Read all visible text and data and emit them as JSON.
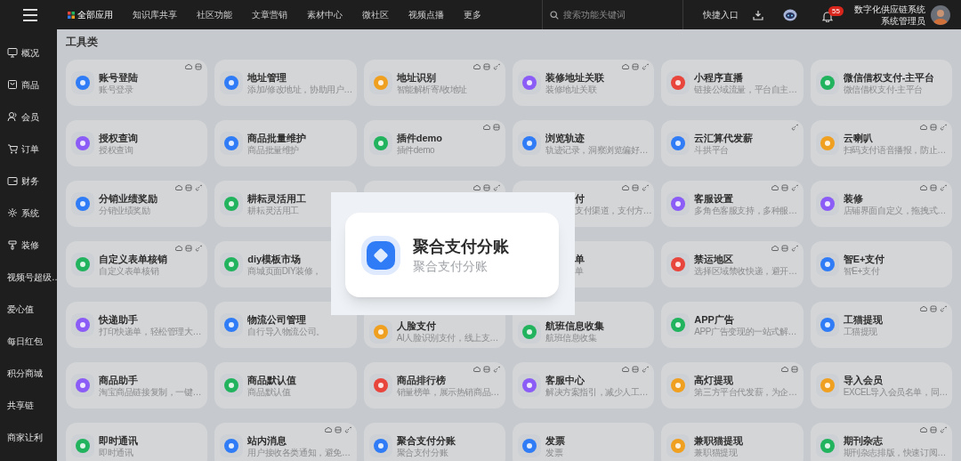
{
  "top_bar": {
    "nav": [
      {
        "label": "全部应用",
        "selected": true
      },
      {
        "label": "知识库共享",
        "selected": false
      },
      {
        "label": "社区功能",
        "selected": false
      },
      {
        "label": "文章营销",
        "selected": false
      },
      {
        "label": "素材中心",
        "selected": false
      },
      {
        "label": "微社区",
        "selected": false
      },
      {
        "label": "视频点播",
        "selected": false
      },
      {
        "label": "更多",
        "selected": false
      }
    ],
    "search": {
      "placeholder": "搜索功能关键词"
    },
    "quick_entry": "快捷入口",
    "notifications": "55",
    "user": {
      "org": "数字化供应链系统",
      "role": "系统管理员"
    }
  },
  "sidebar": {
    "items": [
      {
        "label": "概况"
      },
      {
        "label": "商品"
      },
      {
        "label": "会员"
      },
      {
        "label": "订单"
      },
      {
        "label": "财务"
      },
      {
        "label": "系统"
      },
      {
        "label": "装修"
      },
      {
        "label": "视频号超级…"
      },
      {
        "label": "爱心值"
      },
      {
        "label": "每日红包"
      },
      {
        "label": "积分商城"
      },
      {
        "label": "共享链"
      },
      {
        "label": "商家让利"
      }
    ]
  },
  "section_title": "工具类",
  "cards": [
    {
      "kind": "full",
      "title": "账号登陆",
      "subtitle": "账号登录",
      "color": "#2f7cf6",
      "cloud": true,
      "storage": true,
      "link": false
    },
    {
      "kind": "full",
      "title": "地址管理",
      "subtitle": "添加/修改地址，协助用户…",
      "color": "#2f7cf6",
      "cloud": false,
      "storage": false,
      "link": false
    },
    {
      "kind": "full",
      "title": "地址识别",
      "subtitle": "智能解析寄/收地址",
      "color": "#f0a020",
      "cloud": true,
      "storage": true,
      "link": true
    },
    {
      "kind": "full",
      "title": "装修地址关联",
      "subtitle": "装修地址关联",
      "color": "#8b5cf6",
      "cloud": true,
      "storage": true,
      "link": true
    },
    {
      "kind": "full",
      "title": "小程序直播",
      "subtitle": "链接公域流量，平台自主…",
      "color": "#e8453c",
      "cloud": false,
      "storage": false,
      "link": false
    },
    {
      "kind": "full",
      "title": "微信借权支付-主平台",
      "subtitle": "微信借权支付-主平台",
      "color": "#22b35e",
      "cloud": false,
      "storage": false,
      "link": false
    },
    {
      "kind": "full",
      "title": "授权查询",
      "subtitle": "授权查询",
      "color": "#8b5cf6",
      "cloud": false,
      "storage": false,
      "link": false
    },
    {
      "kind": "full",
      "title": "商品批量维护",
      "subtitle": "商品批量维护",
      "color": "#2f7cf6",
      "cloud": false,
      "storage": false,
      "link": false
    },
    {
      "kind": "full",
      "title": "插件demo",
      "subtitle": "插件demo",
      "color": "#22b35e",
      "cloud": true,
      "storage": true,
      "link": false
    },
    {
      "kind": "full",
      "title": "浏览轨迹",
      "subtitle": "轨迹记录，洞察浏览偏好…",
      "color": "#2f7cf6",
      "cloud": false,
      "storage": false,
      "link": false
    },
    {
      "kind": "full",
      "title": "云汇算代发薪",
      "subtitle": "斗拱平台",
      "color": "#2f7cf6",
      "cloud": false,
      "storage": false,
      "link": true
    },
    {
      "kind": "full",
      "title": "云喇叭",
      "subtitle": "扫码支付语音播报，防止…",
      "color": "#f0a020",
      "cloud": true,
      "storage": true,
      "link": true
    },
    {
      "kind": "full",
      "title": "分销业绩奖励",
      "subtitle": "分销业绩奖励",
      "color": "#2f7cf6",
      "cloud": true,
      "storage": true,
      "link": true
    },
    {
      "kind": "full",
      "title": "耕耘灵活用工",
      "subtitle": "耕耘灵活用工",
      "color": "#22b35e",
      "cloud": false,
      "storage": false,
      "link": false
    },
    {
      "kind": "top",
      "cloud": true,
      "storage": true,
      "link": true
    },
    {
      "kind": "partial",
      "title": "付",
      "subtitle": "支付渠道，支付方…",
      "cloud": true,
      "storage": true,
      "link": true
    },
    {
      "kind": "full",
      "title": "客服设置",
      "subtitle": "多角色客服支持，多种服…",
      "color": "#8b5cf6",
      "cloud": true,
      "storage": true,
      "link": true
    },
    {
      "kind": "full",
      "title": "装修",
      "subtitle": "店铺界面自定义，拖拽式…",
      "color": "#8b5cf6",
      "cloud": true,
      "storage": true,
      "link": true
    },
    {
      "kind": "full",
      "title": "自定义表单核销",
      "subtitle": "自定义表单核销",
      "color": "#22b35e",
      "cloud": true,
      "storage": true,
      "link": true
    },
    {
      "kind": "left",
      "title": "diy模板市场",
      "subtitle": "商城页面DIY装修，",
      "color": "#22b35e",
      "cloud": false,
      "storage": false,
      "link": false
    },
    {
      "kind": "hidden"
    },
    {
      "kind": "partial",
      "title": "单",
      "subtitle": "单",
      "cloud": false,
      "storage": false,
      "link": false
    },
    {
      "kind": "full",
      "title": "禁运地区",
      "subtitle": "选择区域禁收快递，避开…",
      "color": "#e8453c",
      "cloud": true,
      "storage": true,
      "link": true
    },
    {
      "kind": "full",
      "title": "智E+支付",
      "subtitle": "智E+支付",
      "color": "#2f7cf6",
      "cloud": false,
      "storage": false,
      "link": false
    },
    {
      "kind": "full",
      "title": "快递助手",
      "subtitle": "打印快递单，轻松管理大…",
      "color": "#8b5cf6",
      "cloud": false,
      "storage": false,
      "link": false
    },
    {
      "kind": "full",
      "title": "物流公司管理",
      "subtitle": "自行导入物流公司。",
      "color": "#2f7cf6",
      "cloud": false,
      "storage": false,
      "link": false
    },
    {
      "kind": "under",
      "title": "人脸支付",
      "subtitle": "AI人脸识别支付，线上支…",
      "color": "#f0a020",
      "cloud": false,
      "storage": false,
      "link": false
    },
    {
      "kind": "under",
      "title": "航班信息收集",
      "subtitle": "航班信息收集",
      "color": "#22b35e",
      "cloud": false,
      "storage": false,
      "link": false
    },
    {
      "kind": "full",
      "title": "APP广告",
      "subtitle": "APP广告变现的一站式解…",
      "color": "#22b35e",
      "cloud": false,
      "storage": false,
      "link": false
    },
    {
      "kind": "full",
      "title": "工猫提现",
      "subtitle": "工猫提现",
      "color": "#2f7cf6",
      "cloud": true,
      "storage": true,
      "link": true
    },
    {
      "kind": "full",
      "title": "商品助手",
      "subtitle": "淘宝商品链接复制，一键…",
      "color": "#8b5cf6",
      "cloud": false,
      "storage": false,
      "link": false
    },
    {
      "kind": "full",
      "title": "商品默认值",
      "subtitle": "商品默认值",
      "color": "#22b35e",
      "cloud": false,
      "storage": false,
      "link": false
    },
    {
      "kind": "full",
      "title": "商品排行榜",
      "subtitle": "销量榜单，展示热销商品…",
      "color": "#e8453c",
      "cloud": true,
      "storage": true,
      "link": true
    },
    {
      "kind": "full",
      "title": "客服中心",
      "subtitle": "解决方案指引，减少人工…",
      "color": "#8b5cf6",
      "cloud": true,
      "storage": true,
      "link": true
    },
    {
      "kind": "full",
      "title": "高灯提现",
      "subtitle": "第三方平台代发薪，为企…",
      "color": "#f0a020",
      "cloud": true,
      "storage": true,
      "link": false
    },
    {
      "kind": "full",
      "title": "导入会员",
      "subtitle": "EXCEL导入会员名单，同…",
      "color": "#f0a020",
      "cloud": false,
      "storage": false,
      "link": false
    },
    {
      "kind": "full",
      "title": "即时通讯",
      "subtitle": "即时通讯",
      "color": "#22b35e",
      "cloud": false,
      "storage": false,
      "link": false
    },
    {
      "kind": "full",
      "title": "站内消息",
      "subtitle": "用户接收各类通知，避免…",
      "color": "#2f7cf6",
      "cloud": true,
      "storage": true,
      "link": true
    },
    {
      "kind": "full",
      "title": "聚合支付分账",
      "subtitle": "聚合支付分账",
      "color": "#2f7cf6",
      "cloud": false,
      "storage": false,
      "link": false
    },
    {
      "kind": "full",
      "title": "发票",
      "subtitle": "发票",
      "color": "#2f7cf6",
      "cloud": false,
      "storage": false,
      "link": false
    },
    {
      "kind": "full",
      "title": "兼职猫提现",
      "subtitle": "兼职猫提现",
      "color": "#f0a020",
      "cloud": false,
      "storage": false,
      "link": false
    },
    {
      "kind": "full",
      "title": "期刊杂志",
      "subtitle": "期刊杂志排版，快速订阅…",
      "color": "#22b35e",
      "cloud": true,
      "storage": true,
      "link": true
    }
  ],
  "popup": {
    "title": "聚合支付分账",
    "subtitle": "聚合支付分账",
    "color": "#2f7cf6"
  }
}
